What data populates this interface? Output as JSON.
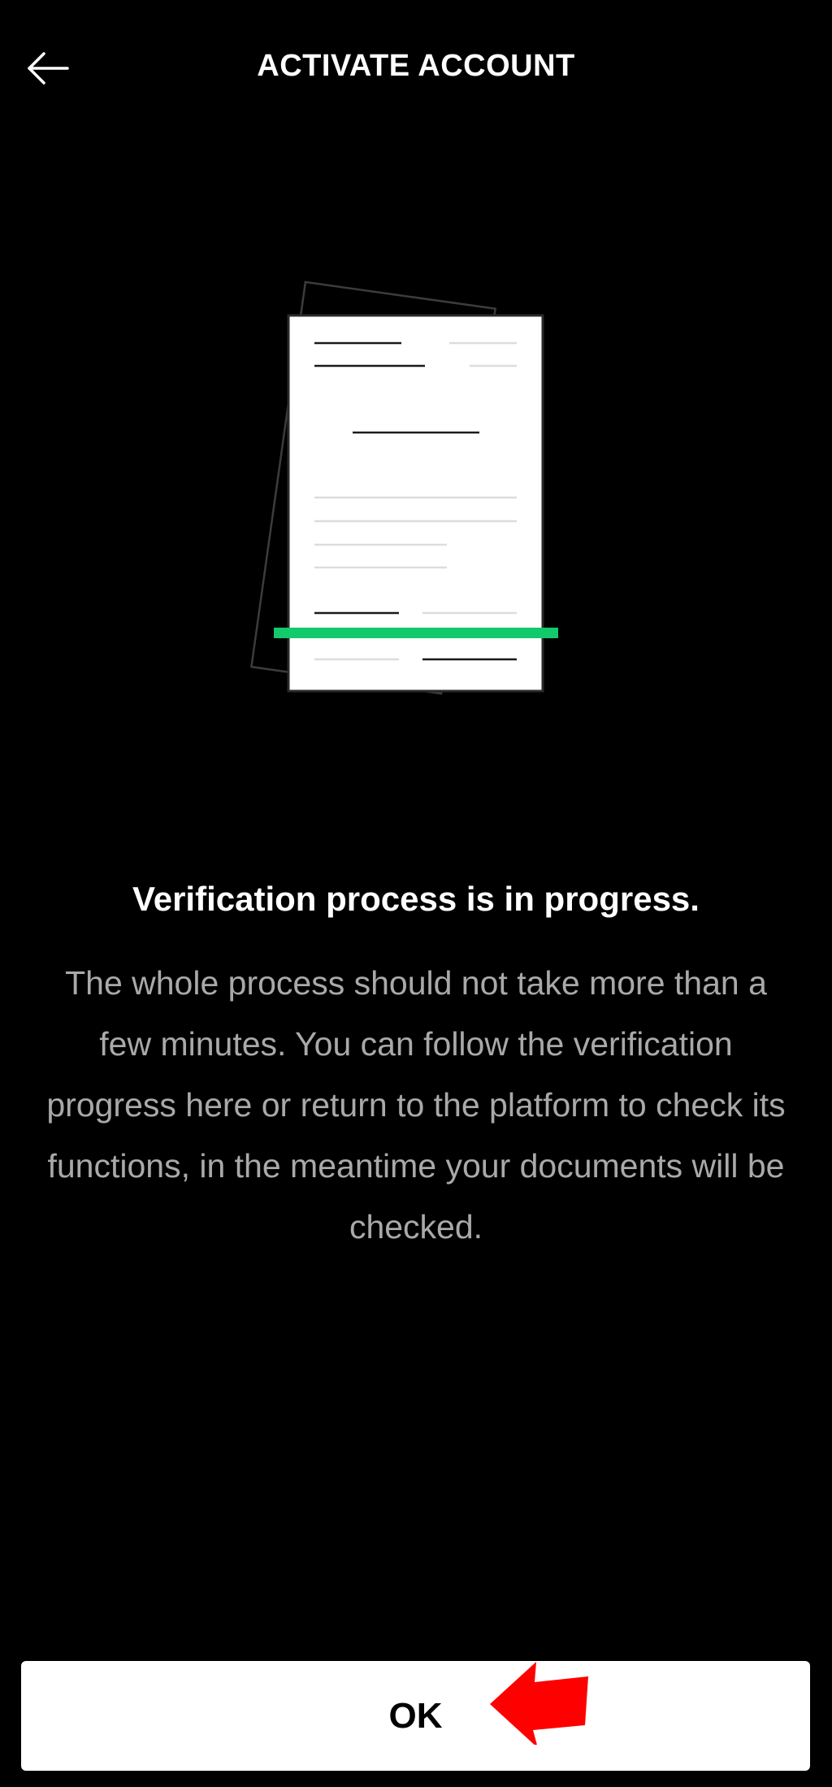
{
  "header": {
    "title": "ACTIVATE ACCOUNT",
    "back_icon": "arrow-left-icon"
  },
  "illustration": {
    "icon": "document-scan-illustration",
    "scan_line_color": "#12c96b"
  },
  "content": {
    "heading": "Verification process is in progress.",
    "body": "The whole process should not take more than a few minutes. You can follow the verification progress here or return to the platform to check its functions, in the meantime your documents will be checked."
  },
  "footer": {
    "ok_label": "OK",
    "annotation_icon": "red-arrow-pointer-icon",
    "annotation_color": "#ff0000"
  }
}
